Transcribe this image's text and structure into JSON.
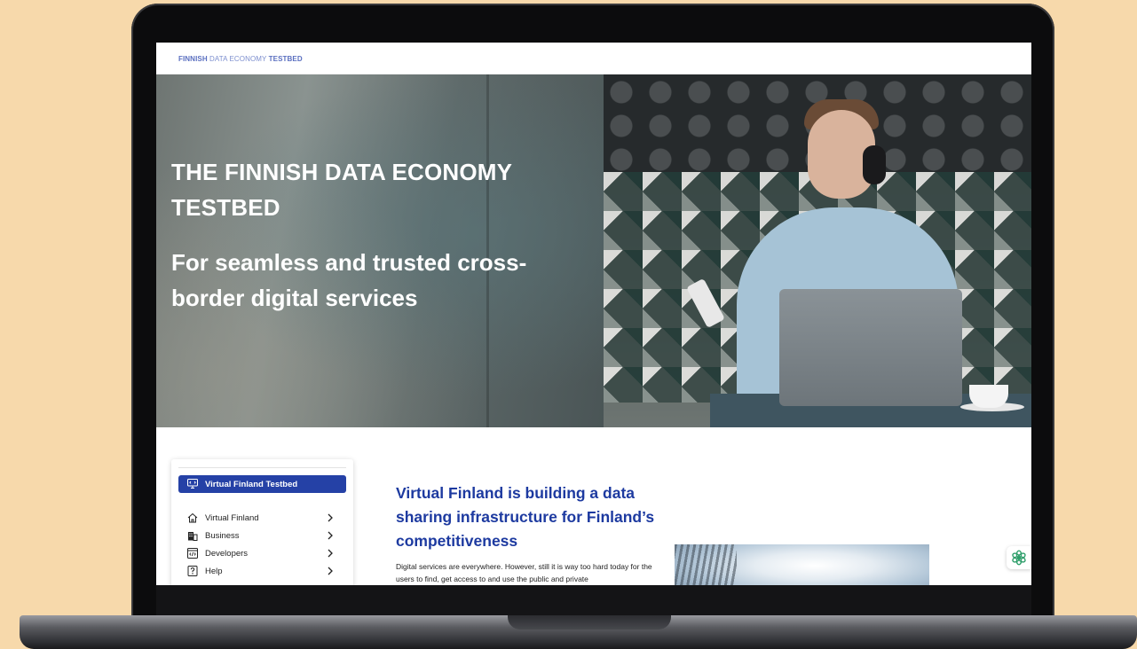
{
  "header": {
    "brand_part1": "FINNISH",
    "brand_part2": " DATA ECONOMY ",
    "brand_part3": "TESTBED"
  },
  "hero": {
    "title": "THE FINNISH DATA ECONOMY TESTBED",
    "subtitle": "For seamless and trusted cross-border digital services"
  },
  "sidebar": {
    "active_item": {
      "label": "Virtual Finland Testbed",
      "icon": "monitor-code-icon"
    },
    "items": [
      {
        "label": "Virtual Finland",
        "icon": "home-icon"
      },
      {
        "label": "Business",
        "icon": "building-icon"
      },
      {
        "label": "Developers",
        "icon": "code-icon"
      },
      {
        "label": "Help",
        "icon": "help-icon"
      }
    ]
  },
  "article": {
    "title": "Virtual Finland is building a data sharing infrastructure for Finland’s competitiveness",
    "body": "Digital services are everywhere. However, still it is way too hard today for the users to find, get access to and use the public and private"
  },
  "colors": {
    "accent": "#2541a6",
    "title_blue": "#1d3aa0",
    "brand_blue": "#5a6fc0",
    "background": "#f7d9ab",
    "assistant": "#2e9e6a"
  }
}
